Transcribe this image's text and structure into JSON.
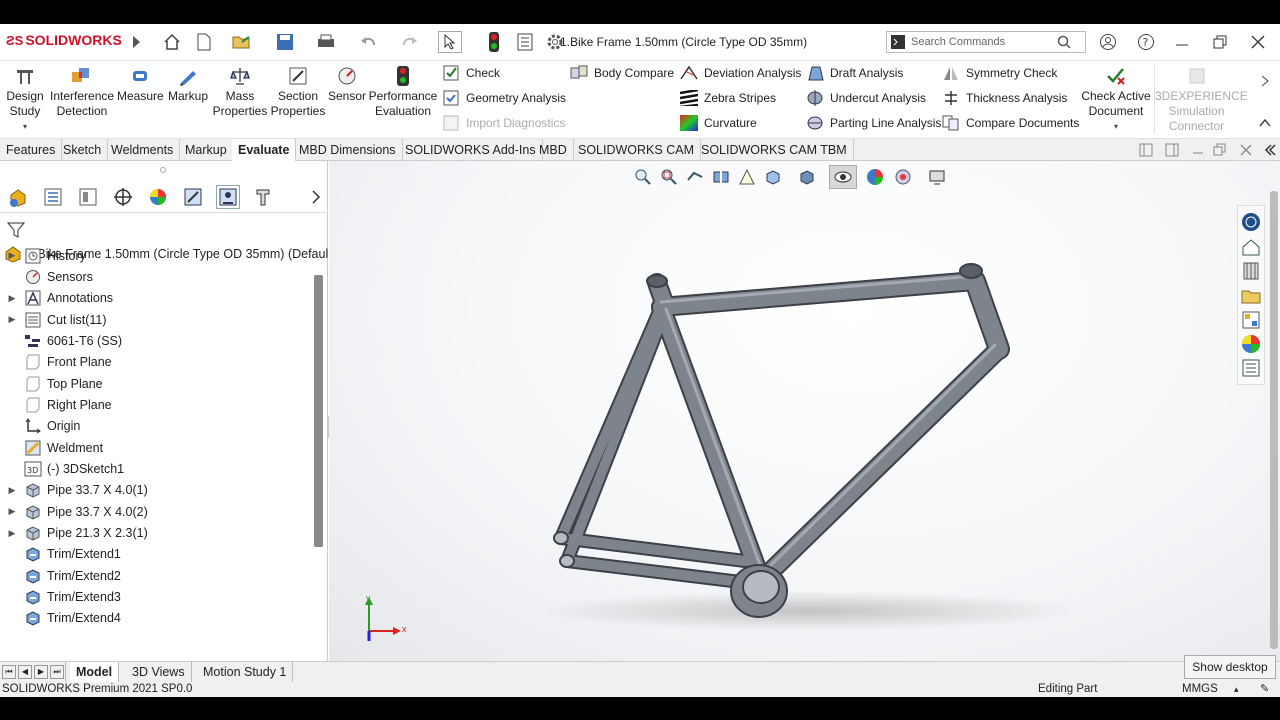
{
  "app": {
    "brand": "SOLIDWORKS",
    "document_title": "1.Bike Frame 1.50mm (Circle Type OD 35mm)"
  },
  "search": {
    "placeholder": "Search Commands"
  },
  "ribbon": {
    "big_buttons": [
      {
        "label1": "Design",
        "label2": "Study",
        "icon": "design-study-icon"
      },
      {
        "label1": "Interference",
        "label2": "Detection",
        "icon": "interference-detection-icon"
      },
      {
        "label1": "Measure",
        "label2": "",
        "icon": "measure-icon"
      },
      {
        "label1": "Markup",
        "label2": "",
        "icon": "markup-icon"
      },
      {
        "label1": "Mass",
        "label2": "Properties",
        "icon": "mass-properties-icon"
      },
      {
        "label1": "Section",
        "label2": "Properties",
        "icon": "section-properties-icon"
      },
      {
        "label1": "Sensor",
        "label2": "",
        "icon": "sensor-icon"
      },
      {
        "label1": "Performance",
        "label2": "Evaluation",
        "icon": "performance-evaluation-icon"
      }
    ],
    "list_col1": [
      "Check",
      "Geometry Analysis",
      "Import Diagnostics"
    ],
    "list_col2": [
      "Body Compare"
    ],
    "list_col3": [
      "Deviation Analysis",
      "Zebra Stripes",
      "Curvature"
    ],
    "list_col4": [
      "Draft Analysis",
      "Undercut Analysis",
      "Parting Line Analysis"
    ],
    "list_col5": [
      "Symmetry Check",
      "Thickness Analysis",
      "Compare Documents"
    ],
    "check_active": {
      "label1": "Check Active",
      "label2": "Document"
    },
    "experience": {
      "label1": "3DEXPERIENCE",
      "label2": "Simulation",
      "label3": "Connector"
    }
  },
  "tabs": [
    "Features",
    "Sketch",
    "Weldments",
    "Markup",
    "Evaluate",
    "MBD Dimensions",
    "SOLIDWORKS Add-Ins",
    "MBD",
    "SOLIDWORKS CAM",
    "SOLIDWORKS CAM TBM"
  ],
  "active_tab": "Evaluate",
  "tree": {
    "root": "1.Bike Frame 1.50mm (Circle Type OD 35mm)  (Defaul",
    "items": [
      {
        "label": "History",
        "expandable": true,
        "icon": "history-icon"
      },
      {
        "label": "Sensors",
        "expandable": false,
        "icon": "sensor-folder-icon"
      },
      {
        "label": "Annotations",
        "expandable": true,
        "icon": "annotations-icon"
      },
      {
        "label": "Cut list(11)",
        "expandable": true,
        "icon": "cut-list-icon"
      },
      {
        "label": "6061-T6 (SS)",
        "expandable": false,
        "icon": "material-icon"
      },
      {
        "label": "Front Plane",
        "expandable": false,
        "icon": "plane-icon"
      },
      {
        "label": "Top Plane",
        "expandable": false,
        "icon": "plane-icon"
      },
      {
        "label": "Right Plane",
        "expandable": false,
        "icon": "plane-icon"
      },
      {
        "label": "Origin",
        "expandable": false,
        "icon": "origin-icon"
      },
      {
        "label": "Weldment",
        "expandable": false,
        "icon": "weldment-icon"
      },
      {
        "label": "(-) 3DSketch1",
        "expandable": false,
        "icon": "3dsketch-icon"
      },
      {
        "label": "Pipe 33.7 X 4.0(1)",
        "expandable": true,
        "icon": "structural-member-icon"
      },
      {
        "label": "Pipe 33.7 X 4.0(2)",
        "expandable": true,
        "icon": "structural-member-icon"
      },
      {
        "label": "Pipe 21.3 X 2.3(1)",
        "expandable": true,
        "icon": "structural-member-icon"
      },
      {
        "label": "Trim/Extend1",
        "expandable": false,
        "icon": "trim-extend-icon"
      },
      {
        "label": "Trim/Extend2",
        "expandable": false,
        "icon": "trim-extend-icon"
      },
      {
        "label": "Trim/Extend3",
        "expandable": false,
        "icon": "trim-extend-icon"
      },
      {
        "label": "Trim/Extend4",
        "expandable": false,
        "icon": "trim-extend-icon"
      }
    ]
  },
  "bottom_tabs": [
    "Model",
    "3D Views",
    "Motion Study 1"
  ],
  "status": {
    "left": "SOLIDWORKS Premium 2021 SP0.0",
    "mode": "Editing Part",
    "units": "MMGS"
  },
  "tooltip": "Show desktop",
  "triad": {
    "x": "x",
    "y": "y"
  },
  "colors": {
    "brand_red": "#d0102a",
    "tube_gray": "#7e848c"
  }
}
